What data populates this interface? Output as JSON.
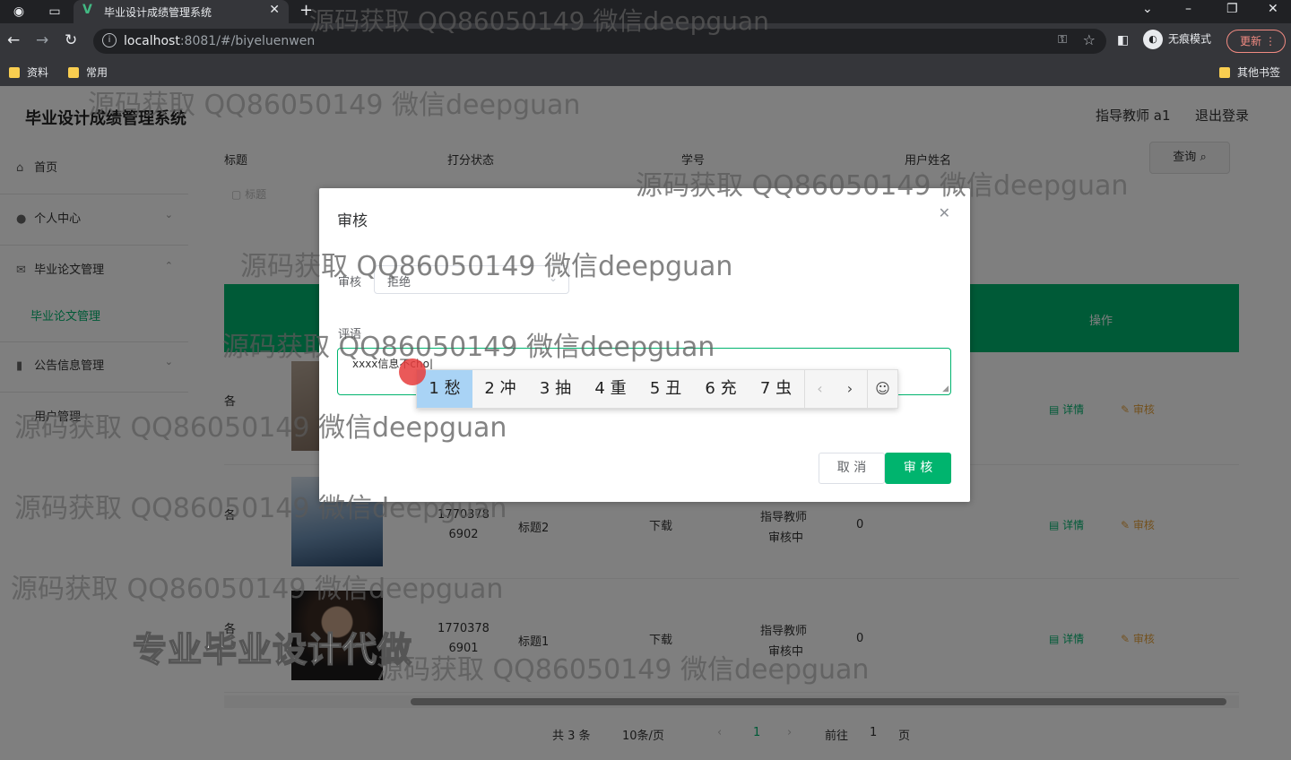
{
  "browser": {
    "tab_title": "毕业设计成绩管理系统",
    "tab_favicon": "V",
    "url_host": "localhost",
    "url_rest": ":8081/#/biyeluenwen",
    "profile_label": "无痕模式",
    "update_label": "更新",
    "bookmarks": [
      "资料",
      "常用"
    ],
    "other_bookmarks": "其他书签"
  },
  "app": {
    "title": "毕业设计成绩管理系统",
    "user_label": "指导教师 a1",
    "logout_label": "退出登录"
  },
  "sidebar": {
    "items": [
      {
        "label": "首页",
        "icon": "home-icon"
      },
      {
        "label": "个人中心",
        "icon": "user-icon"
      },
      {
        "label": "毕业论文管理",
        "icon": "mail-icon"
      },
      {
        "label": "毕业论文管理",
        "icon": ""
      },
      {
        "label": "公告信息管理",
        "icon": "bar-chart-icon"
      },
      {
        "label": "用户管理",
        "icon": ""
      }
    ]
  },
  "search": {
    "labels": [
      "标题",
      "打分状态",
      "学号",
      "用户姓名"
    ],
    "query_button": "查询",
    "add_button": "标题"
  },
  "table": {
    "header_action": "操作",
    "rows": [
      {
        "prefix": "各",
        "student_id": "",
        "title": "",
        "download": "",
        "status_line1": "",
        "status_line2": "",
        "score": "",
        "detail": "详情",
        "review": "审核"
      },
      {
        "prefix": "各",
        "student_id": "1770378 6902",
        "title": "标题2",
        "download": "下载",
        "status_line1": "指导教师",
        "status_line2": "审核中",
        "score": "0",
        "detail": "详情",
        "review": "审核"
      },
      {
        "prefix": "各",
        "student_id": "1770378 6901",
        "title": "标题1",
        "download": "下载",
        "status_line1": "指导教师",
        "status_line2": "审核中",
        "score": "0",
        "detail": "详情",
        "review": "审核"
      }
    ]
  },
  "pager": {
    "total": "共 3 条",
    "page_size": "10条/页",
    "current": "1",
    "goto_prefix": "前往",
    "goto_value": "1",
    "goto_suffix": "页"
  },
  "dialog": {
    "title": "审核",
    "review_label": "审核",
    "review_value": "拒绝",
    "comment_label": "评语",
    "comment_typed": "xxxx信息不cho|",
    "cancel_label": "取 消",
    "ok_label": "审 核"
  },
  "ime": {
    "candidates": [
      "1 愁",
      "2 冲",
      "3 抽",
      "4 重",
      "5 丑",
      "6 充",
      "7 虫"
    ],
    "selected_index": 0
  },
  "watermarks": {
    "text": "源码获取 QQ86050149 微信deepguan",
    "banner": "专业毕业设计代做"
  },
  "colors": {
    "accent": "#00b46e",
    "warning": "#e6a23c",
    "browser_dark": "#202124"
  }
}
